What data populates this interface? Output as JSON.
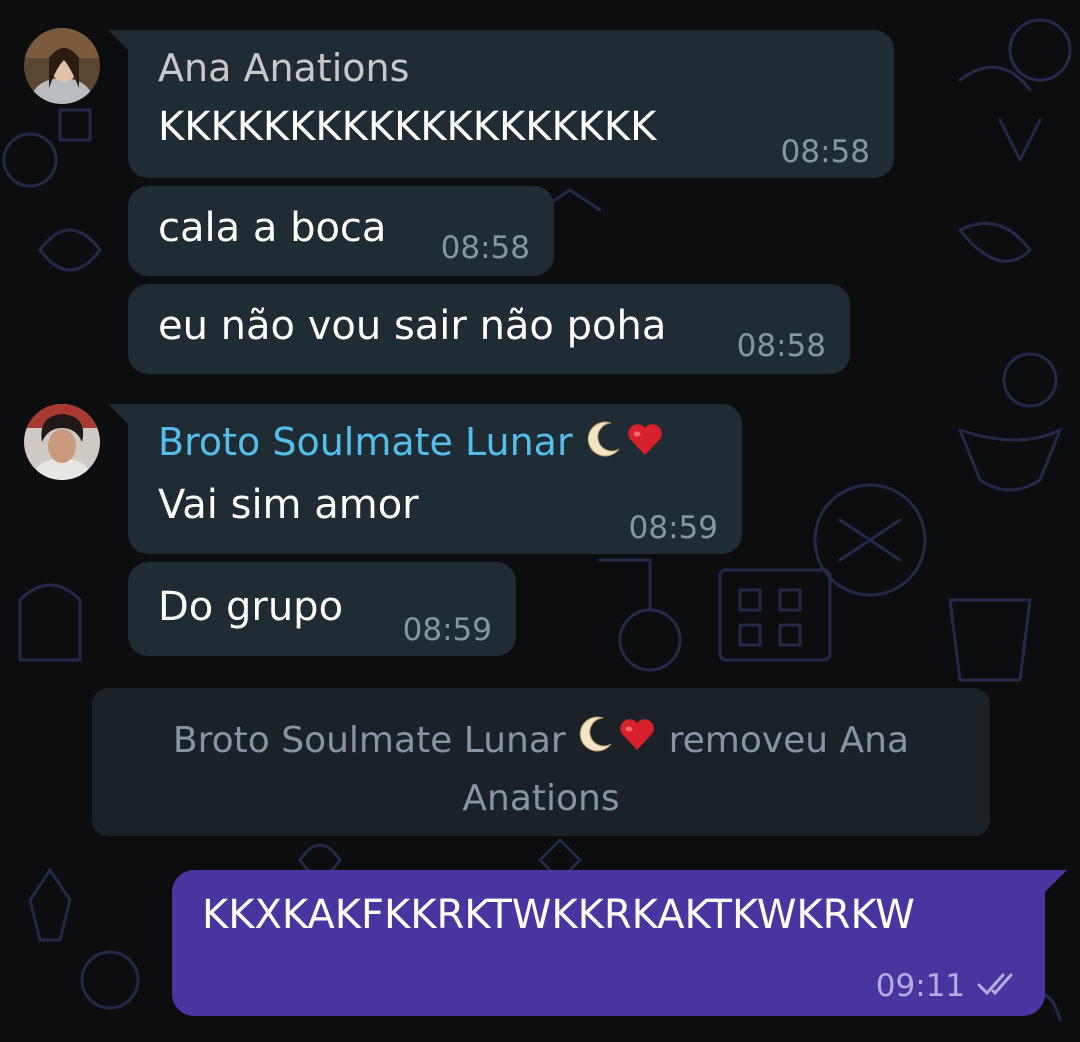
{
  "colors": {
    "incoming_bubble": "#202c33",
    "outgoing_bubble": "#4a34a0",
    "system_bubble": "#1a2227",
    "sender_ana": "#c9c9c9",
    "sender_broto": "#53bdeb",
    "timestamp": "#8696a0",
    "background": "#0b0d0f"
  },
  "messages": [
    {
      "sender": "Ana Anations",
      "text": "KKKKKKKKKKKKKKKKKKK",
      "time": "08:58"
    },
    {
      "text": "cala a boca",
      "time": "08:58"
    },
    {
      "text": "eu não vou sair não poha",
      "time": "08:58"
    },
    {
      "sender": "Broto Soulmate Lunar",
      "sender_emoji": [
        "crescent-moon",
        "red-heart"
      ],
      "text": "Vai sim amor",
      "time": "08:59"
    },
    {
      "text": "Do grupo",
      "time": "08:59"
    }
  ],
  "system_message": {
    "actor": "Broto Soulmate Lunar",
    "emoji": [
      "crescent-moon",
      "red-heart"
    ],
    "action": "removeu Ana",
    "line2": "Anations"
  },
  "outgoing": {
    "text": "KKXKAKFKKRKTWKKRKAKTKWKRKW",
    "time": "09:11",
    "status_icon": "double-check-icon"
  }
}
